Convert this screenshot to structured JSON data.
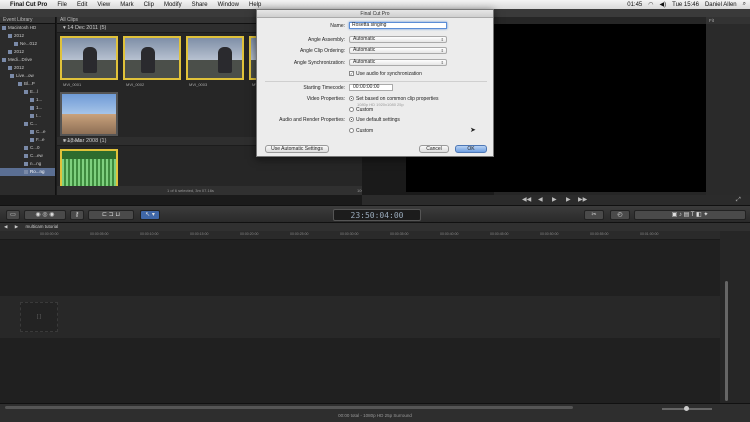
{
  "menubar": {
    "app_name": "Final Cut Pro",
    "items": [
      "File",
      "Edit",
      "View",
      "Mark",
      "Clip",
      "Modify",
      "Share",
      "Window",
      "Help"
    ],
    "status": {
      "battery": "01:45",
      "time": "Tue 15:46",
      "user": "Daniel Allen"
    }
  },
  "window_title": "Final Cut Pro",
  "library": {
    "header": "Event Library",
    "rows": [
      "Macintosh HD",
      "2012",
      "Ne...012",
      "2012",
      "Medi...Drive",
      "2012",
      "Live...ow",
      "Bl...P",
      "E...l",
      "1...",
      "1...",
      "t...",
      "C...",
      "C...e",
      "F...e",
      "C...0",
      "C...ew",
      "n...ng",
      "Ro...ng"
    ]
  },
  "browser": {
    "header": "All Clips",
    "groups": [
      {
        "date": "14 Dec 2011  (5)",
        "clips": [
          "MVI_0001",
          "MVI_0002",
          "MVI_0003",
          "MVI_0004",
          "MVI_0008"
        ]
      },
      {
        "date": "18 Mar 2008  (1)",
        "clips": [
          ""
        ]
      }
    ],
    "footer_msg": "1 of 6 selected, 3m 07.16s",
    "footer_zoom": "10s"
  },
  "dialog": {
    "title": "Final Cut Pro",
    "name_label": "Name:",
    "name_value": "Rosetta singing",
    "angle_assembly_label": "Angle Assembly:",
    "angle_assembly_value": "Automatic",
    "angle_ordering_label": "Angle Clip Ordering:",
    "angle_ordering_value": "Automatic",
    "angle_sync_label": "Angle Synchronization:",
    "angle_sync_value": "Automatic",
    "use_audio_label": "Use audio for synchronization",
    "starting_tc_label": "Starting Timecode:",
    "starting_tc_value": "00:00:00:00",
    "video_props_label": "Video Properties:",
    "video_opt1": "Set based on common clip properties",
    "video_opt1_sub": "1080p HD 1920x1080 25p",
    "video_opt2": "Custom",
    "audio_props_label": "Audio and Render Properties:",
    "audio_opt1": "Use default settings",
    "audio_opt2": "Custom",
    "auto_settings_btn": "Use Automatic Settings",
    "cancel_btn": "Cancel",
    "ok_btn": "OK"
  },
  "viewer": {
    "header": "Fit"
  },
  "toolbar": {
    "timecode": "23:50:04:00"
  },
  "timeline": {
    "project_name": "multicam tutorial",
    "ruler_ticks": [
      "00:00:00:00",
      "00:00:05:00",
      "00:00:10:00",
      "00:00:15:00",
      "00:00:20:00",
      "00:00:25:00",
      "00:00:30:00",
      "00:00:35:00",
      "00:00:40:00",
      "00:00:45:00",
      "00:00:50:00",
      "00:00:55:00",
      "00:01:00:00"
    ],
    "footer_info": "00:00 total - 1080p HD 25p Surround"
  }
}
